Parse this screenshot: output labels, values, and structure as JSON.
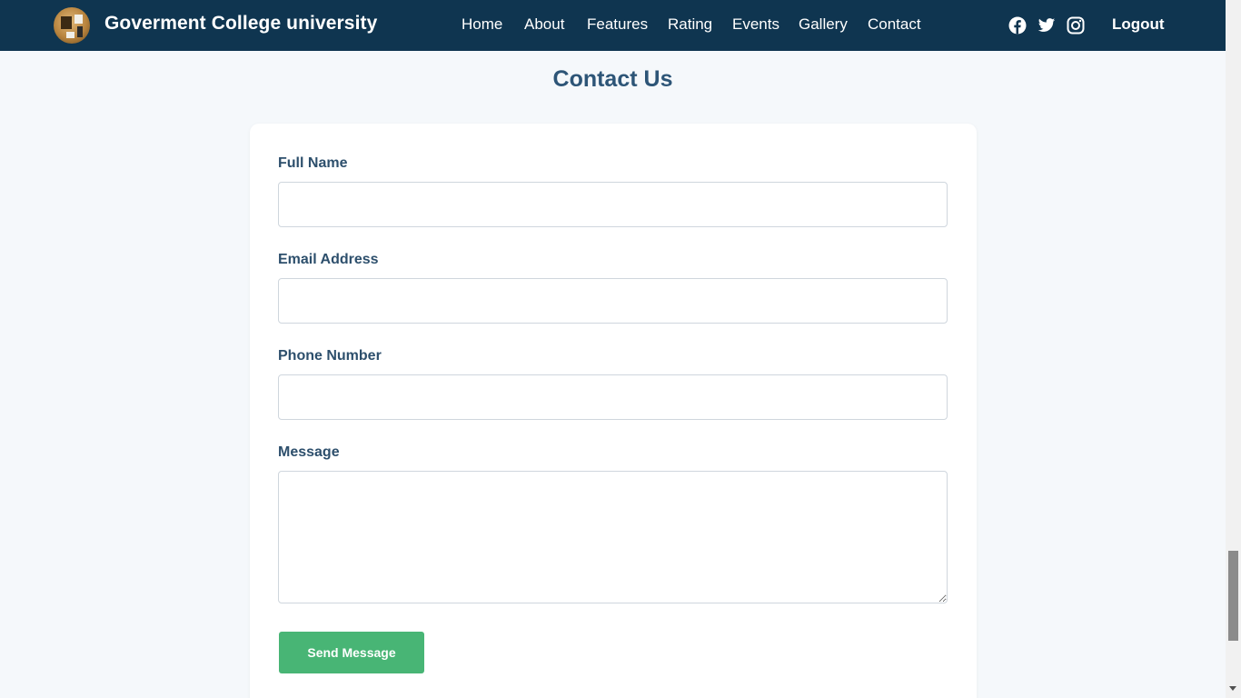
{
  "header": {
    "brand_title": "Goverment College university",
    "logo_icon": "college-logo",
    "nav": [
      {
        "label": "Home"
      },
      {
        "label": "About"
      },
      {
        "label": "Features"
      },
      {
        "label": "Rating"
      },
      {
        "label": "Events"
      },
      {
        "label": "Gallery"
      },
      {
        "label": "Contact"
      }
    ],
    "social_icons": [
      "facebook-icon",
      "twitter-icon",
      "instagram-icon"
    ],
    "logout_label": "Logout"
  },
  "contact": {
    "title": "Contact Us",
    "fields": {
      "full_name": {
        "label": "Full Name",
        "value": ""
      },
      "email": {
        "label": "Email Address",
        "value": ""
      },
      "phone": {
        "label": "Phone Number",
        "value": ""
      },
      "message": {
        "label": "Message",
        "value": ""
      }
    },
    "submit_label": "Send Message"
  },
  "colors": {
    "navbar_bg": "#0f3550",
    "page_bg": "#f5f8fb",
    "heading": "#2d5577",
    "button_bg": "#48b575"
  }
}
